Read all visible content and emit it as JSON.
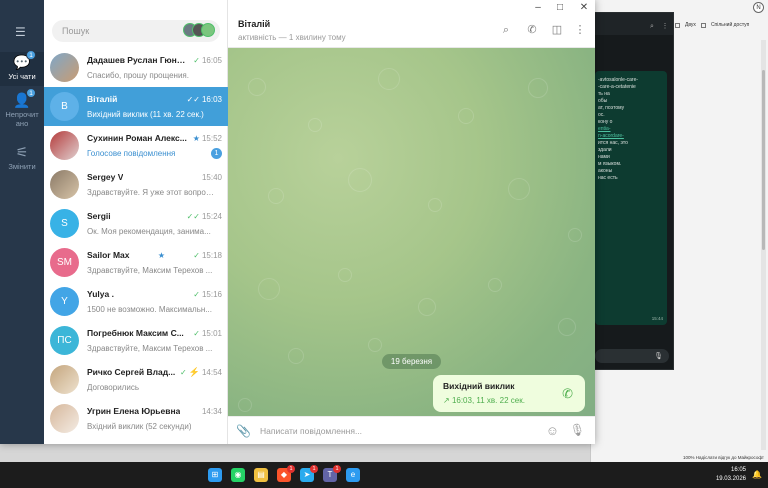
{
  "background": {
    "browser": {
      "toolbar_items": [
        "Двух",
        "Спільний доступ"
      ],
      "profile_initial": "N",
      "footer_text": "100%   Надіслати відгук до Майкрософт"
    },
    "whatsapp": {
      "message_lines": [
        "-avtosalonle-care-",
        "-care-a-cetatenie",
        "",
        "ть на",
        "",
        "обы",
        "ат, поэтому",
        "ос.",
        "",
        "кону о",
        "",
        "entia-",
        "n-acordare-",
        "",
        "ится нас, это",
        "",
        "здали",
        "нами",
        "м языком.",
        "аконы",
        "нас есть"
      ],
      "time": "15:44"
    }
  },
  "telegram": {
    "rail": {
      "menu_icon": "hamburger-icon",
      "folders": [
        {
          "label": "Усі чати",
          "badge": "1",
          "icon": "chats-icon"
        },
        {
          "label": "Непрочит ано",
          "badge": "1",
          "icon": "user-unread-icon"
        },
        {
          "label": "Змінити",
          "badge": "",
          "icon": "sliders-icon"
        }
      ]
    },
    "search": {
      "placeholder": "Пошук"
    },
    "chats": [
      {
        "name": "Дадашев Руслан Гюнд...",
        "time": "16:05",
        "preview": "Спасибо, прошу прощения.",
        "initials": "",
        "check": "✓",
        "style": "photo1"
      },
      {
        "name": "Віталій",
        "time": "16:03",
        "preview": "Вихідний виклик (11 хв. 22 сек.)",
        "initials": "В",
        "check": "✓✓",
        "style": "selected"
      },
      {
        "name": "Сухинин Роман Алекс...",
        "time": "15:52",
        "preview": "Голосове повідомлення",
        "initials": "",
        "check": "★",
        "unread": "1",
        "style": "photo2"
      },
      {
        "name": "Sergey V",
        "time": "15:40",
        "preview": "Здравствуйте. Я уже этот вопрос...",
        "initials": "",
        "check": "",
        "style": "photo3"
      },
      {
        "name": "Sergii",
        "time": "15:24",
        "preview": "Ок. Моя рекомендация, занима...",
        "initials": "S",
        "check": "✓✓",
        "style": "cyan"
      },
      {
        "name": "Sailor Max",
        "time": "15:18",
        "preview": "Здравствуйте, Максим Терехов ...",
        "initials": "SM",
        "check": "✓",
        "style": "pink"
      },
      {
        "name": "Yulya .",
        "time": "15:16",
        "preview": "1500 не возможно. Максимальн...",
        "initials": "Y",
        "check": "✓",
        "style": "blue"
      },
      {
        "name": "Погребнюк Максим С...",
        "time": "15:01",
        "preview": "Здравствуйте, Максим Терехов ...",
        "initials": "ПС",
        "check": "✓",
        "style": "cyan2"
      },
      {
        "name": "Ричко Сергей Влад...",
        "time": "14:54",
        "preview": "Договорились",
        "initials": "",
        "check": "✓",
        "style": "photo4"
      },
      {
        "name": "Угрин Елена Юрьевна",
        "time": "14:34",
        "preview": "Вхідний виклик (52 секунди)",
        "initials": "",
        "check": "",
        "style": "photo5"
      }
    ],
    "conversation": {
      "title": "Віталій",
      "status": "активність — 1 хвилину тому",
      "date_pill": "19 березня",
      "call_title": "Вихідний виклик",
      "call_detail": "16:03, 11 хв. 22 сек.",
      "composer_placeholder": "Написати повідомлення..."
    }
  },
  "taskbar": {
    "time": "16:05",
    "date": "19.03.2026",
    "apps": [
      {
        "icon": "windows-start-icon",
        "color": "#2d9bf0"
      },
      {
        "icon": "whatsapp-icon",
        "color": "#25d366"
      },
      {
        "icon": "file-explorer-icon",
        "color": "#f0c040"
      },
      {
        "icon": "brave-icon",
        "color": "#fb542b",
        "badge": "1"
      },
      {
        "icon": "telegram-icon",
        "color": "#2aabee",
        "badge": "1"
      },
      {
        "icon": "teams-icon",
        "color": "#6264a7",
        "badge": "1"
      },
      {
        "icon": "edge-icon",
        "color": "#2d9bf0"
      }
    ]
  },
  "colors": {
    "accent": "#419fd9",
    "rail": "#27374a",
    "bubble": "#effdde",
    "check": "#4fbf6a"
  }
}
